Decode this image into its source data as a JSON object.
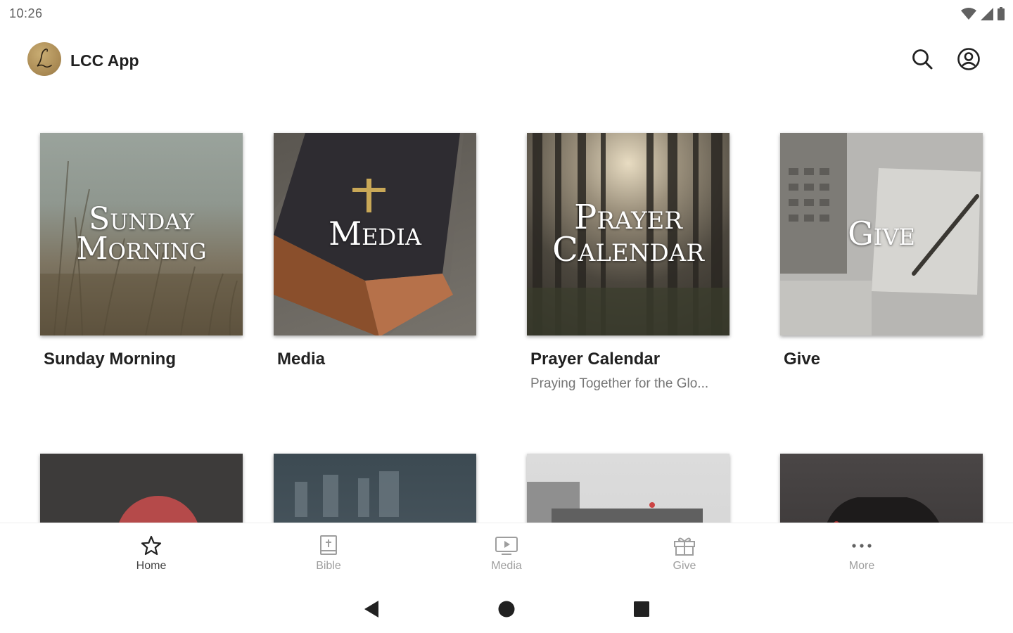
{
  "status_bar": {
    "time": "10:26",
    "icons": [
      "wifi-icon",
      "signal-icon",
      "battery-icon"
    ]
  },
  "app_bar": {
    "title": "LCC App",
    "logo_letter": "L",
    "actions": [
      "search-icon",
      "account-icon"
    ]
  },
  "tiles": [
    {
      "image_text": "Sunday\nMorning",
      "title": "Sunday Morning",
      "subtitle": ""
    },
    {
      "image_text": "Media",
      "title": "Media",
      "subtitle": ""
    },
    {
      "image_text": "Prayer\nCalendar",
      "title": "Prayer Calendar",
      "subtitle": "Praying Together for the Glo..."
    },
    {
      "image_text": "Give",
      "title": "Give",
      "subtitle": ""
    }
  ],
  "bottom_nav": {
    "items": [
      {
        "label": "Home",
        "icon": "star-icon",
        "active": true
      },
      {
        "label": "Bible",
        "icon": "bible-icon",
        "active": false
      },
      {
        "label": "Media",
        "icon": "media-icon",
        "active": false
      },
      {
        "label": "Give",
        "icon": "gift-icon",
        "active": false
      },
      {
        "label": "More",
        "icon": "more-icon",
        "active": false
      }
    ]
  },
  "colors": {
    "primary_text": "#212121",
    "secondary_text": "#757575",
    "nav_inactive": "#9e9e9e",
    "logo_gold": "#a88852"
  }
}
